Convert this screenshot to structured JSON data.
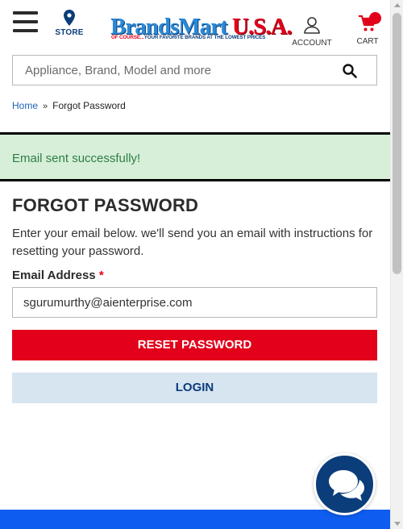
{
  "header": {
    "menu_icon": "hamburger-menu-icon",
    "store_label": "STORE",
    "logo": {
      "brand_part1": "BrandsMart",
      "brand_part2": "U.S.A.",
      "tagline_red": "OF COURSE...",
      "tagline_blue": "YOUR FAVORITE BRANDS AT THE LOWEST PRICES"
    },
    "account_label": "ACCOUNT",
    "cart_label": "CART"
  },
  "search": {
    "placeholder": "Appliance, Brand, Model and more",
    "icon": "search-icon"
  },
  "breadcrumb": {
    "home": "Home",
    "separator": "»",
    "current": "Forgot Password"
  },
  "alert": {
    "message": "Email sent successfully!"
  },
  "form": {
    "title": "FORGOT PASSWORD",
    "description": "Enter your email below. we'll send you an email with instructions for resetting your password.",
    "email_label": "Email Address",
    "required_marker": "*",
    "email_value": "sgurumurthy@aienterprise.com",
    "reset_button": "RESET PASSWORD",
    "login_button": "LOGIN"
  },
  "colors": {
    "brand_red": "#e2001a",
    "brand_navy": "#0b3d7a",
    "success_bg": "#d7efd9",
    "success_text": "#2e7d45",
    "login_bg": "#d7e5f1",
    "footer_blue": "#0f5df0"
  },
  "chat": {
    "icon": "chat-bubbles-icon"
  }
}
